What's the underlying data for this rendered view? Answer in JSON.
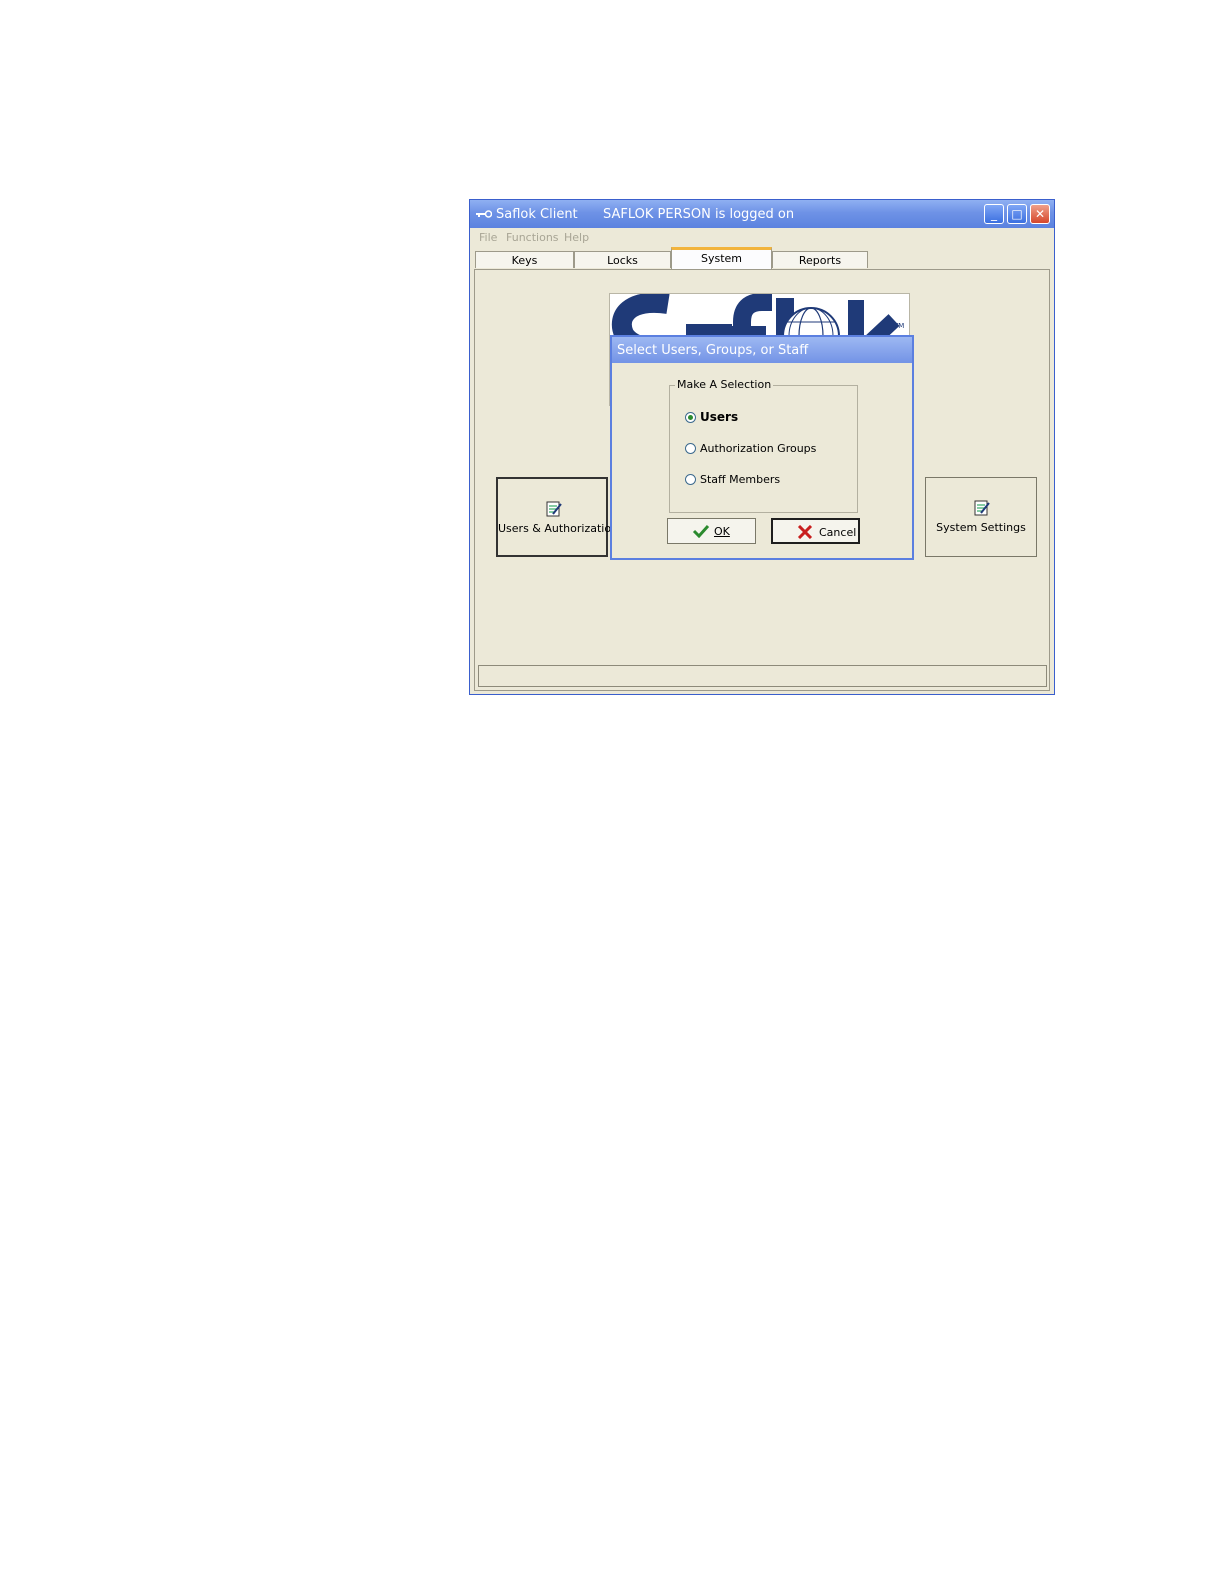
{
  "window": {
    "app_title": "Saflok Client",
    "user_status": "SAFLOK PERSON is logged on",
    "min_glyph": "_",
    "max_glyph": "□",
    "close_glyph": "✕"
  },
  "menu": {
    "items": [
      "File",
      "Functions",
      "Help"
    ]
  },
  "tabs": {
    "items": [
      "Keys",
      "Locks",
      "System",
      "Reports"
    ],
    "active": "System"
  },
  "panel": {
    "users_button_label": "Users & Authorizations",
    "settings_button_label": "System Settings"
  },
  "dialog": {
    "title": "Select Users, Groups, or Staff",
    "group_label": "Make A Selection",
    "options": [
      "Users",
      "Authorization Groups",
      "Staff Members"
    ],
    "selected": "Users",
    "ok_label": "OK",
    "cancel_label": "Cancel"
  },
  "colors": {
    "titlebar": "#6e92e6",
    "window_bg": "#ece9d8",
    "logo_blue": "#1f3a78",
    "active_tab_accent": "#f2b43c"
  }
}
